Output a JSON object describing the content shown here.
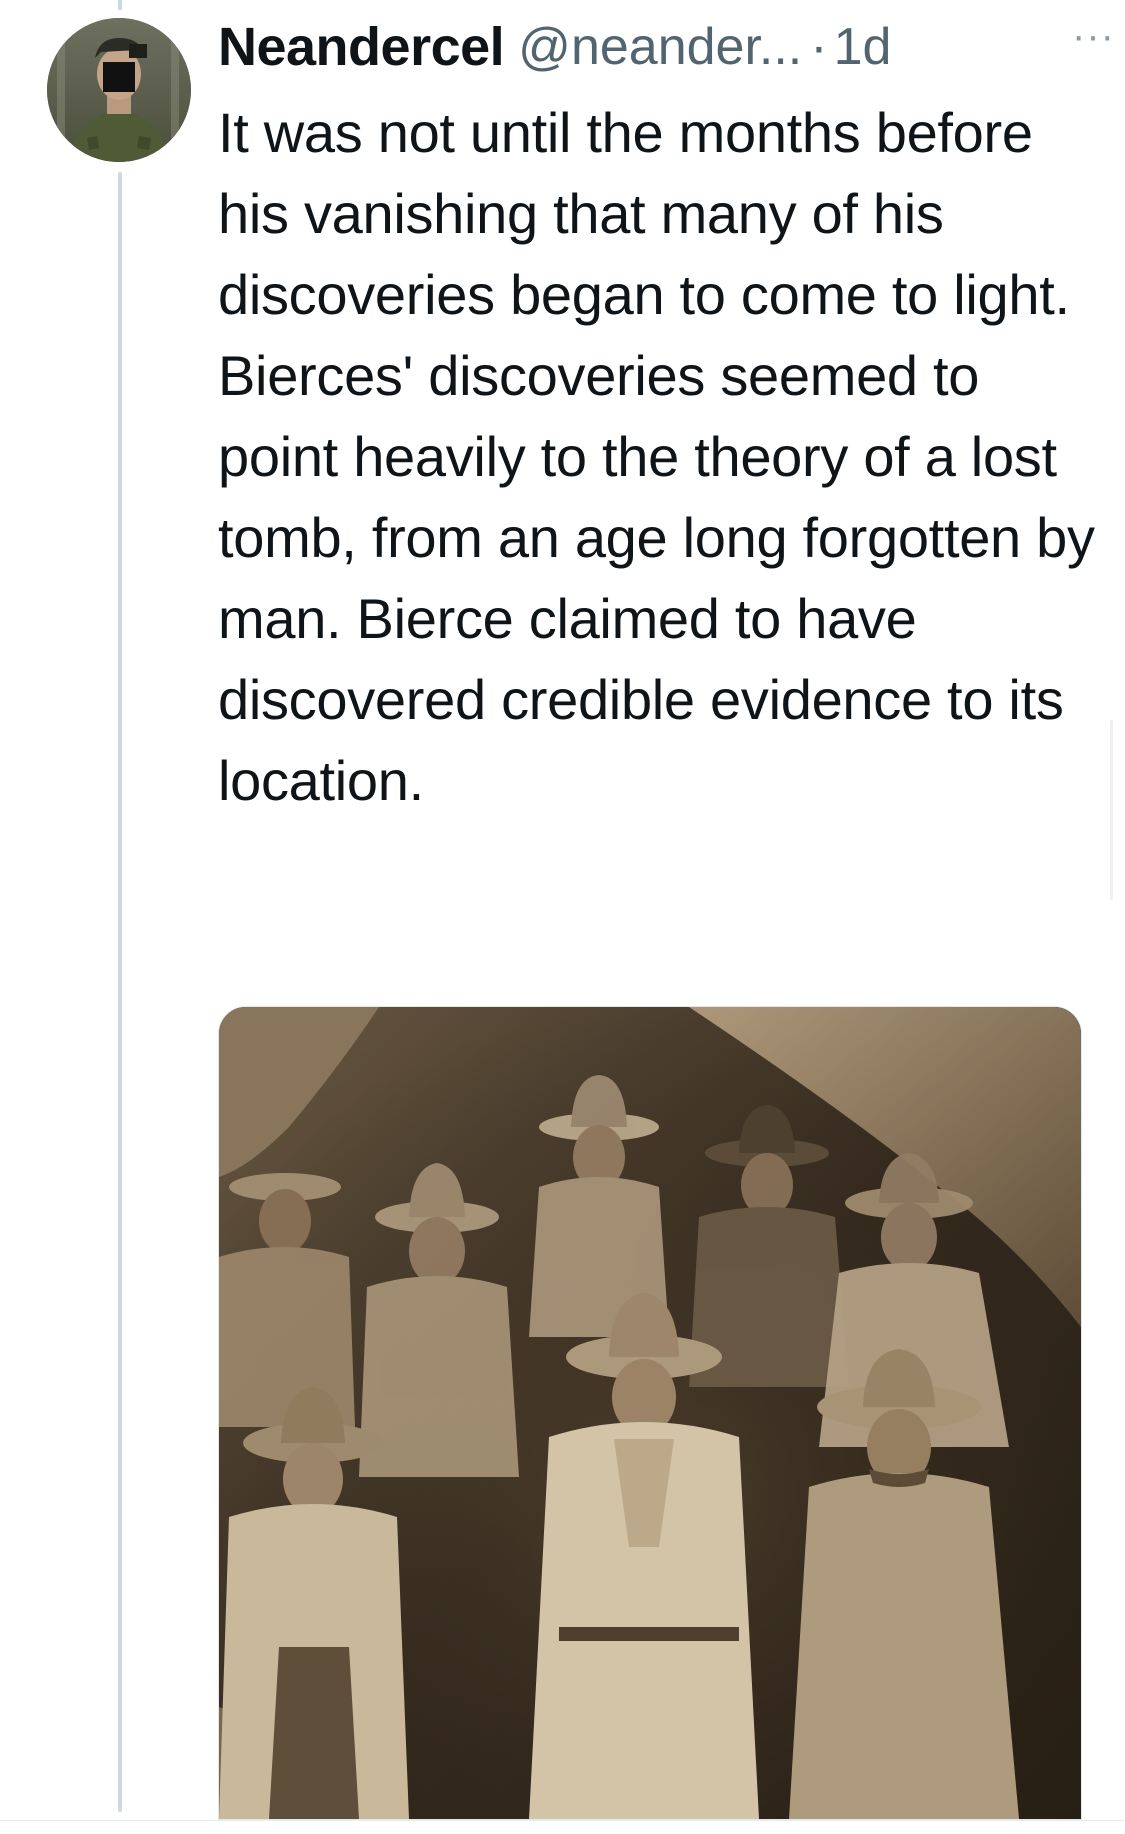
{
  "tweet": {
    "author": {
      "display_name": "Neandercel",
      "handle": "@neander...",
      "avatar_icon": "avatar-soldier-photo"
    },
    "separator": "·",
    "timestamp": "1d",
    "more_icon": "more-horizontal-icon",
    "more_glyph": "···",
    "text": "It was not until the months before his vanishing that many of his discoveries began to come to light. Bierces' discoveries seemed to point heavily to the theory of a lost tomb, from an age long forgotten by man. Bierce claimed to have discovered credible evidence to its location.",
    "media": {
      "type": "image",
      "icon": "sepia-group-photo"
    }
  },
  "colors": {
    "text_primary": "#0f1419",
    "text_secondary": "#536471",
    "thread_line": "#cfd9de"
  }
}
